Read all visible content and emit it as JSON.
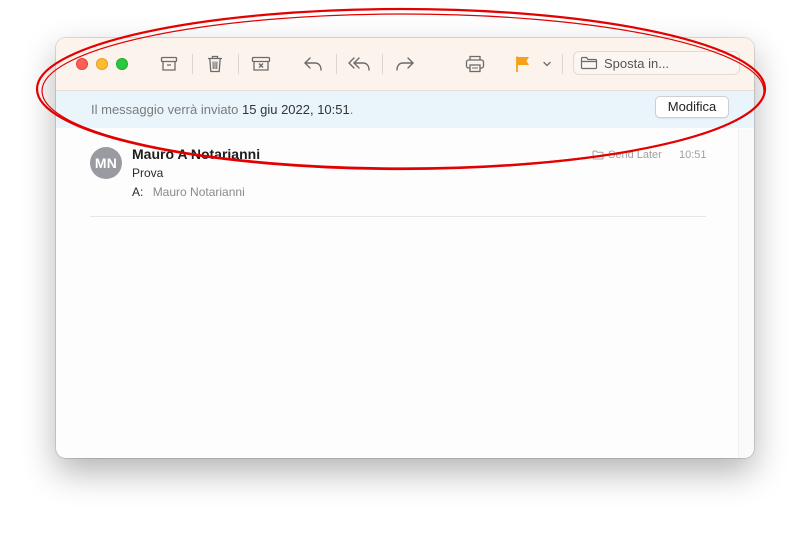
{
  "toolbar": {
    "move_label": "Sposta in..."
  },
  "banner": {
    "prefix": "Il messaggio verrà inviato",
    "date": "15 giu 2022, 10:51",
    "suffix": ".",
    "edit_label": "Modifica"
  },
  "message": {
    "avatar_initials": "MN",
    "sender": "Mauro A Notarianni",
    "subject": "Prova",
    "to_label": "A:",
    "recipient": "Mauro Notarianni",
    "mailbox": "Send Later",
    "time": "10:51"
  },
  "colors": {
    "toolbar_bg": "#fbf3ec",
    "banner_bg": "#eaf4fb",
    "flag": "#f7a11a",
    "annotation": "#e30000",
    "avatar_bg": "#9a9ba1"
  },
  "icons": [
    "archive-icon",
    "trash-icon",
    "junk-icon",
    "reply-icon",
    "reply-all-icon",
    "forward-icon",
    "print-icon",
    "flag-icon",
    "chevron-down-icon",
    "folder-icon"
  ]
}
